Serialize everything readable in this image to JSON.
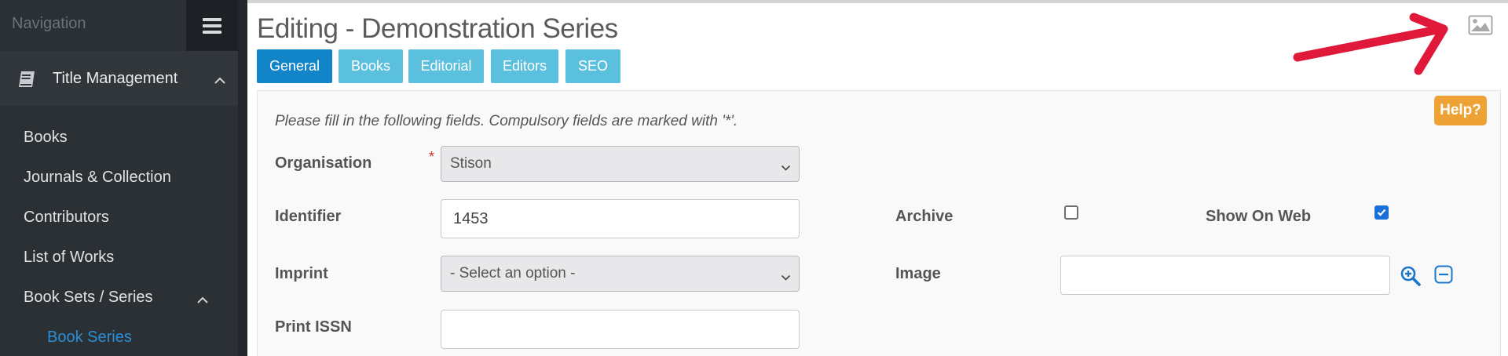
{
  "sidebar": {
    "header_label": "Navigation",
    "section_label": "Title Management",
    "items": [
      {
        "label": "Books"
      },
      {
        "label": "Journals & Collection"
      },
      {
        "label": "Contributors"
      },
      {
        "label": "List of Works"
      },
      {
        "label": "Book Sets / Series"
      },
      {
        "label": "Book Series"
      }
    ]
  },
  "page": {
    "title": "Editing - Demonstration Series",
    "tabs": [
      {
        "label": "General"
      },
      {
        "label": "Books"
      },
      {
        "label": "Editorial"
      },
      {
        "label": "Editors"
      },
      {
        "label": "SEO"
      }
    ],
    "help_label": "Help?",
    "instruction": "Please fill in the following fields. Compulsory fields are marked with '*'."
  },
  "form": {
    "organisation": {
      "label": "Organisation",
      "required_mark": "*",
      "value": "Stison"
    },
    "identifier": {
      "label": "Identifier",
      "value": "1453"
    },
    "imprint": {
      "label": "Imprint",
      "value": "- Select an option -"
    },
    "print_issn": {
      "label": "Print ISSN",
      "value": ""
    },
    "archive": {
      "label": "Archive",
      "checked": false
    },
    "show_on_web": {
      "label": "Show On Web",
      "checked": true
    },
    "image": {
      "label": "Image",
      "value": ""
    }
  },
  "colors": {
    "accent": "#1285c8",
    "tab": "#5bc0de",
    "help": "#eea236",
    "arrow": "#e0193a"
  }
}
